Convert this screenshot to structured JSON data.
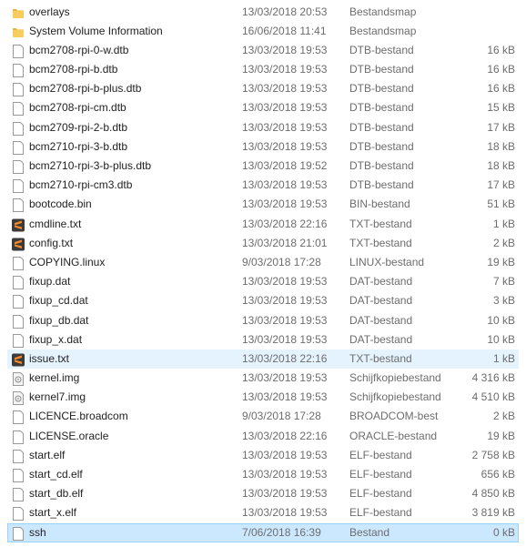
{
  "colors": {
    "hover": "#e5f3ff",
    "selected": "#cce8ff",
    "selected_border": "#99d1ff",
    "folder": "#f3c24f",
    "sublime": "#f58a2a"
  },
  "files": [
    {
      "name": "overlays",
      "date": "13/03/2018 20:53",
      "type": "Bestandsmap",
      "size": "",
      "icon": "folder-icon"
    },
    {
      "name": "System Volume Information",
      "date": "16/06/2018 11:41",
      "type": "Bestandsmap",
      "size": "",
      "icon": "folder-icon"
    },
    {
      "name": "bcm2708-rpi-0-w.dtb",
      "date": "13/03/2018 19:53",
      "type": "DTB-bestand",
      "size": "16 kB",
      "icon": "file-icon"
    },
    {
      "name": "bcm2708-rpi-b.dtb",
      "date": "13/03/2018 19:53",
      "type": "DTB-bestand",
      "size": "16 kB",
      "icon": "file-icon"
    },
    {
      "name": "bcm2708-rpi-b-plus.dtb",
      "date": "13/03/2018 19:53",
      "type": "DTB-bestand",
      "size": "16 kB",
      "icon": "file-icon"
    },
    {
      "name": "bcm2708-rpi-cm.dtb",
      "date": "13/03/2018 19:53",
      "type": "DTB-bestand",
      "size": "15 kB",
      "icon": "file-icon"
    },
    {
      "name": "bcm2709-rpi-2-b.dtb",
      "date": "13/03/2018 19:53",
      "type": "DTB-bestand",
      "size": "17 kB",
      "icon": "file-icon"
    },
    {
      "name": "bcm2710-rpi-3-b.dtb",
      "date": "13/03/2018 19:53",
      "type": "DTB-bestand",
      "size": "18 kB",
      "icon": "file-icon"
    },
    {
      "name": "bcm2710-rpi-3-b-plus.dtb",
      "date": "13/03/2018 19:52",
      "type": "DTB-bestand",
      "size": "18 kB",
      "icon": "file-icon"
    },
    {
      "name": "bcm2710-rpi-cm3.dtb",
      "date": "13/03/2018 19:53",
      "type": "DTB-bestand",
      "size": "17 kB",
      "icon": "file-icon"
    },
    {
      "name": "bootcode.bin",
      "date": "13/03/2018 19:53",
      "type": "BIN-bestand",
      "size": "51 kB",
      "icon": "file-icon"
    },
    {
      "name": "cmdline.txt",
      "date": "13/03/2018 22:16",
      "type": "TXT-bestand",
      "size": "1 kB",
      "icon": "sublime-text-icon"
    },
    {
      "name": "config.txt",
      "date": "13/03/2018 21:01",
      "type": "TXT-bestand",
      "size": "2 kB",
      "icon": "sublime-text-icon"
    },
    {
      "name": "COPYING.linux",
      "date": "9/03/2018 17:28",
      "type": "LINUX-bestand",
      "size": "19 kB",
      "icon": "file-icon"
    },
    {
      "name": "fixup.dat",
      "date": "13/03/2018 19:53",
      "type": "DAT-bestand",
      "size": "7 kB",
      "icon": "file-icon"
    },
    {
      "name": "fixup_cd.dat",
      "date": "13/03/2018 19:53",
      "type": "DAT-bestand",
      "size": "3 kB",
      "icon": "file-icon"
    },
    {
      "name": "fixup_db.dat",
      "date": "13/03/2018 19:53",
      "type": "DAT-bestand",
      "size": "10 kB",
      "icon": "file-icon"
    },
    {
      "name": "fixup_x.dat",
      "date": "13/03/2018 19:53",
      "type": "DAT-bestand",
      "size": "10 kB",
      "icon": "file-icon"
    },
    {
      "name": "issue.txt",
      "date": "13/03/2018 22:16",
      "type": "TXT-bestand",
      "size": "1 kB",
      "icon": "sublime-text-icon",
      "state": "hover"
    },
    {
      "name": "kernel.img",
      "date": "13/03/2018 19:53",
      "type": "Schijfkopiebestand",
      "size": "4 316 kB",
      "icon": "disc-image-icon"
    },
    {
      "name": "kernel7.img",
      "date": "13/03/2018 19:53",
      "type": "Schijfkopiebestand",
      "size": "4 510 kB",
      "icon": "disc-image-icon"
    },
    {
      "name": "LICENCE.broadcom",
      "date": "9/03/2018 17:28",
      "type": "BROADCOM-best",
      "size": "2 kB",
      "icon": "file-icon"
    },
    {
      "name": "LICENSE.oracle",
      "date": "13/03/2018 22:16",
      "type": "ORACLE-bestand",
      "size": "19 kB",
      "icon": "file-icon"
    },
    {
      "name": "start.elf",
      "date": "13/03/2018 19:53",
      "type": "ELF-bestand",
      "size": "2 758 kB",
      "icon": "file-icon"
    },
    {
      "name": "start_cd.elf",
      "date": "13/03/2018 19:53",
      "type": "ELF-bestand",
      "size": "656 kB",
      "icon": "file-icon"
    },
    {
      "name": "start_db.elf",
      "date": "13/03/2018 19:53",
      "type": "ELF-bestand",
      "size": "4 850 kB",
      "icon": "file-icon"
    },
    {
      "name": "start_x.elf",
      "date": "13/03/2018 19:53",
      "type": "ELF-bestand",
      "size": "3 819 kB",
      "icon": "file-icon"
    },
    {
      "name": "ssh",
      "date": "7/06/2018 16:39",
      "type": "Bestand",
      "size": "0 kB",
      "icon": "file-icon",
      "state": "selected"
    }
  ]
}
